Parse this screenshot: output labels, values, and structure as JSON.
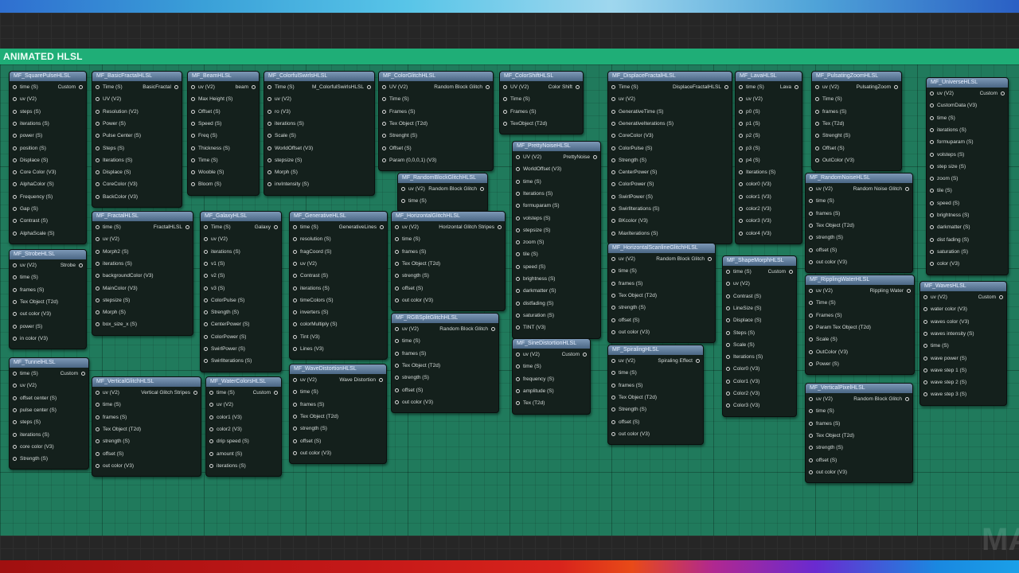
{
  "comment": {
    "title": "ANIMATED HLSL"
  },
  "watermark": "MA",
  "nodes": [
    {
      "id": "squarepulse",
      "title": "MF_SquarePulseHLSL",
      "output": "Custom",
      "inputs": [
        "time (S)",
        "uv (V2)",
        "steps (S)",
        "iterations (S)",
        "power (S)",
        "position (S)",
        "Displace (S)",
        "Core Color (V3)",
        "AlphaColor (S)",
        "Frequency (S)",
        "Gap (S)",
        "Contrast (S)",
        "AlphaScale (S)"
      ]
    },
    {
      "id": "strobe",
      "title": "MF_StrobeHLSL",
      "output": "Strobe",
      "inputs": [
        "uv (V2)",
        "time (S)",
        "frames (S)",
        "Tex Object (T2d)",
        "out color (V3)",
        "power (S)",
        "in color (V3)"
      ]
    },
    {
      "id": "tunnel",
      "title": "MF_TunnelHLSL",
      "output": "Custom",
      "inputs": [
        "time (S)",
        "uv (V2)",
        "offset center (S)",
        "pulse center (S)",
        "steps (S)",
        "iterations (S)",
        "core color (V3)",
        "Strength (S)"
      ]
    },
    {
      "id": "basicfractal",
      "title": "MF_BasicFractalHLSL",
      "output": "BasicFractal",
      "inputs": [
        "Time (S)",
        "UV (V2)",
        "Resolution (V2)",
        "Power (S)",
        "Pulse Center (S)",
        "Steps (S)",
        "Iterations (S)",
        "Displace (S)",
        "CoreColor (V3)",
        "BackColor (V3)"
      ]
    },
    {
      "id": "fractal",
      "title": "MF_FractalHLSL",
      "output": "FractalHLSL",
      "inputs": [
        "time (S)",
        "uv (V2)",
        "Morph2 (S)",
        "iterations (S)",
        "backgroundColor (V3)",
        "MainColor (V3)",
        "stepsize (S)",
        "Morph (S)",
        "box_size_x (S)"
      ]
    },
    {
      "id": "verticalglitch",
      "title": "MF_VerticalGlitchHLSL",
      "output": "Vertical Glitch Stripes",
      "inputs": [
        "uv (V2)",
        "time (S)",
        "frames (S)",
        "Tex Object (T2d)",
        "strength (S)",
        "offset (S)",
        "out color (V3)"
      ]
    },
    {
      "id": "beam",
      "title": "MF_BeamHLSL",
      "output": "beam",
      "inputs": [
        "uv (V2)",
        "Max Height (S)",
        "Offset (S)",
        "Speed (S)",
        "Freq (S)",
        "Thickness (S)",
        "Time (S)",
        "Wooble (S)",
        "Bloom (S)"
      ]
    },
    {
      "id": "galaxy",
      "title": "MF_GalaxyHLSL",
      "output": "Galaxy",
      "inputs": [
        "Time (S)",
        "uv (V2)",
        "iterations (S)",
        "v1 (S)",
        "v2 (S)",
        "v3 (S)",
        "ColorPulse (S)",
        "Strength (S)",
        "CenterPower (S)",
        "ColorPower (S)",
        "SwirlPower (S)",
        "SwirlIterations (S)"
      ]
    },
    {
      "id": "watercolors",
      "title": "MF_WaterColorsHLSL",
      "output": "Custom",
      "inputs": [
        "time (S)",
        "uv (V2)",
        "color1 (V3)",
        "color2 (V3)",
        "drip speed (S)",
        "amount (S)",
        "iterations (S)"
      ]
    },
    {
      "id": "colorfulswirls",
      "title": "MF_ColorfulSwirlsHLSL",
      "output": "M_ColorfulSwirlsHLSL",
      "inputs": [
        "Time (S)",
        "uv (V2)",
        "ro (V3)",
        "iterations (S)",
        "Scale (S)",
        "WorldOffset (V3)",
        "stepsize (S)",
        "Morph (S)",
        "invIntensity (S)"
      ]
    },
    {
      "id": "generative",
      "title": "MF_GenerativeHLSL",
      "output": "GenerativeLines",
      "inputs": [
        "time (S)",
        "resolution (S)",
        "fragCoord (S)",
        "uv (V2)",
        "Contrast (S)",
        "iterations (S)",
        "timeColors (S)",
        "inverters (S)",
        "colorMultiply (S)",
        "Tint (V3)",
        "Lines (V3)"
      ]
    },
    {
      "id": "wavedistortion",
      "title": "MF_WaveDistortionHLSL",
      "output": "Wave Distortion",
      "inputs": [
        "uv (V2)",
        "time (S)",
        "frames (S)",
        "Tex Object (T2d)",
        "strength (S)",
        "offset (S)",
        "out color (V3)"
      ]
    },
    {
      "id": "colorglitch",
      "title": "MF_ColorGlitchHLSL",
      "output": "Random Block Glitch",
      "inputs": [
        "UV (V2)",
        "Time (S)",
        "Frames (S)",
        "Tex Object (T2d)",
        "Strenght (S)",
        "Offset (S)",
        "Param (0,0,0,1) (V3)"
      ]
    },
    {
      "id": "randomblockglitch",
      "title": "MF_RandomBlockGlitchHLSL",
      "output": "Random Block Glitch",
      "inputs": [
        "uv (V2)",
        "time (S)"
      ]
    },
    {
      "id": "horizontalglitch",
      "title": "MF_HorizontalGlitchHLSL",
      "output": "Horizontal Glitch Stripes",
      "inputs": [
        "uv (V2)",
        "time (S)",
        "frames (S)",
        "Tex Object (T2d)",
        "strength (S)",
        "offset (S)",
        "out color (V3)"
      ]
    },
    {
      "id": "rgbsplitglitch",
      "title": "MF_RGBSplitGlitchHLSL",
      "output": "Random Block Glitch",
      "inputs": [
        "uv (V2)",
        "time (S)",
        "frames (S)",
        "Tex Object (T2d)",
        "strength (S)",
        "offset (S)",
        "out color (V3)"
      ]
    },
    {
      "id": "colorshift",
      "title": "MF_ColorShiftHLSL",
      "output": "Color Shift",
      "inputs": [
        "UV (V2)",
        "Time (S)",
        "Frames (S)",
        "TexObject (T2d)"
      ]
    },
    {
      "id": "prettynoise",
      "title": "MF_PrettyNoiseHLSL",
      "output": "PrettyNoise",
      "inputs": [
        "UV (V2)",
        "WorldOffset (V3)",
        "time (S)",
        "Iterations (S)",
        "formuparam (S)",
        "volsteps (S)",
        "stepsize (S)",
        "zoom (S)",
        "tile (S)",
        "speed (S)",
        "brightness (S)",
        "darkmatter (S)",
        "distfading (S)",
        "saturation (S)",
        "TINT (V3)"
      ]
    },
    {
      "id": "sinedistortion",
      "title": "MF_SineDistortionHLSL",
      "output": "Custom",
      "inputs": [
        "uv (V2)",
        "time (S)",
        "frequency (S)",
        "amplitude (S)",
        "Tex (T2d)"
      ]
    },
    {
      "id": "displacefractal",
      "title": "MF_DisplaceFractalHLSL",
      "output": "DisplaceFractalHLSL",
      "inputs": [
        "Time (S)",
        "uv (V2)",
        "GenerativeTime (S)",
        "GenerativeIterations (S)",
        "CoreColor (V3)",
        "ColorPulse (S)",
        "Strength (S)",
        "CenterPower (S)",
        "ColorPower (S)",
        "SwirlPower (S)",
        "SwirlIterations (S)",
        "BKcolor (V3)",
        "MaxIterations (S)"
      ]
    },
    {
      "id": "horizontalscanline",
      "title": "MF_HorizontalScanlineGlitchHLSL",
      "output": "Random Block Glitch",
      "inputs": [
        "uv (V2)",
        "time (S)",
        "frames (S)",
        "Tex Object (T2d)",
        "strength (S)",
        "offset (S)",
        "out color (V3)"
      ]
    },
    {
      "id": "spiraling",
      "title": "MF_SpiralingHLSL",
      "output": "Spiraling Effect",
      "inputs": [
        "uv (V2)",
        "time (S)",
        "frames (S)",
        "Tex Object (T2d)",
        "Strength (S)",
        "offset (S)",
        "out color (V3)"
      ]
    },
    {
      "id": "lava",
      "title": "MF_LavaHLSL",
      "output": "Lava",
      "inputs": [
        "time (S)",
        "uv (V2)",
        "p0 (S)",
        "p1 (S)",
        "p2 (S)",
        "p3 (S)",
        "p4 (S)",
        "Iterations (S)",
        "color0 (V3)",
        "color1 (V3)",
        "color2 (V3)",
        "color3 (V3)",
        "color4 (V3)"
      ]
    },
    {
      "id": "shapemorph",
      "title": "MF_ShapeMorphHLSL",
      "output": "Custom",
      "inputs": [
        "time (S)",
        "uv (V2)",
        "Contrast (S)",
        "LineSize (S)",
        "Displace (S)",
        "Steps (S)",
        "Scale (S)",
        "Iterations (S)",
        "Color0 (V3)",
        "Color1 (V3)",
        "Color2 (V3)",
        "Color3 (V3)"
      ]
    },
    {
      "id": "pulsatingzoom",
      "title": "MF_PulsatingZoomHLSL",
      "output": "PulsatingZoom",
      "inputs": [
        "uv (V2)",
        "Time (S)",
        "frames (S)",
        "Tex (T2d)",
        "Strenght (S)",
        "Offset (S)",
        "OutColor (V3)"
      ]
    },
    {
      "id": "randomnoise",
      "title": "MF_RandomNoiseHLSL",
      "output": "Random Noise Glitch",
      "inputs": [
        "uv (V2)",
        "time (S)",
        "frames (S)",
        "Tex Object (T2d)",
        "strength (S)",
        "offset (S)",
        "out color (V3)"
      ]
    },
    {
      "id": "ripplingwater",
      "title": "MF_RipplingWaterHLSL",
      "output": "Rippling Water",
      "inputs": [
        "uv (V2)",
        "Time (S)",
        "Frames (S)",
        "Param Tex Object (T2d)",
        "Scale (S)",
        "OutColor (V3)",
        "Power (S)"
      ]
    },
    {
      "id": "verticalpixel",
      "title": "MF_VerticalPixelHLSL",
      "output": "Random Block Glitch",
      "inputs": [
        "uv (V2)",
        "time (S)",
        "frames (S)",
        "Tex Object (T2d)",
        "strength (S)",
        "offset (S)",
        "out color (V3)"
      ]
    },
    {
      "id": "universe",
      "title": "MF_UniverseHLSL",
      "output": "Custom",
      "inputs": [
        "uv (V2)",
        "CustomData (V3)",
        "time (S)",
        "iterations (S)",
        "formuparam (S)",
        "volsteps (S)",
        "step size (S)",
        "zoom (S)",
        "tile (S)",
        "speed (S)",
        "brightness (S)",
        "darkmatter (S)",
        "dist fading (S)",
        "saturation (S)",
        "color (V3)"
      ]
    },
    {
      "id": "waves",
      "title": "MF_WavesHLSL",
      "output": "Custom",
      "inputs": [
        "uv (V2)",
        "water color (V3)",
        "waves color (V3)",
        "waves intensity (S)",
        "time (S)",
        "wave power (S)",
        "wave step 1 (S)",
        "wave step 2 (S)",
        "wave step 3 (S)"
      ]
    }
  ]
}
